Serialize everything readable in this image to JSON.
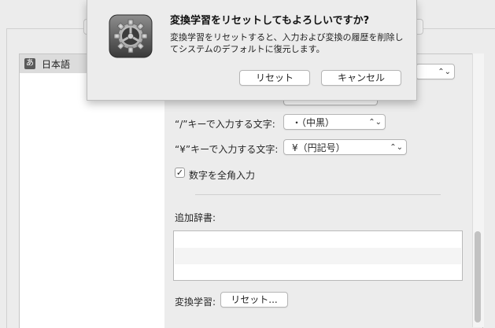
{
  "sheet": {
    "title": "変換学習をリセットしてもよろしいですか?",
    "message": "変換学習をリセットすると、入力および変換の履歴を削除してシステムのデフォルトに復元します。",
    "reset_button": "リセット",
    "cancel_button": "キャンセル",
    "icon": "gear-icon"
  },
  "input_sources": {
    "items": [
      {
        "badge": "あ",
        "label": "日本語",
        "selected": true
      }
    ]
  },
  "prefs": {
    "slash_key_label": "“/”キーで入力する文字:",
    "slash_key_value": "・（中黒）",
    "yen_key_label": "“¥”キーで入力する文字:",
    "yen_key_value": "¥（円記号）",
    "fullwidth_numbers_label": "数字を全角入力",
    "fullwidth_numbers_checked": true,
    "check_mark": "✓",
    "extra_dict_label": "追加辞書:",
    "conversion_learning_label": "変換学習:",
    "conversion_reset_button": "リセット..."
  }
}
